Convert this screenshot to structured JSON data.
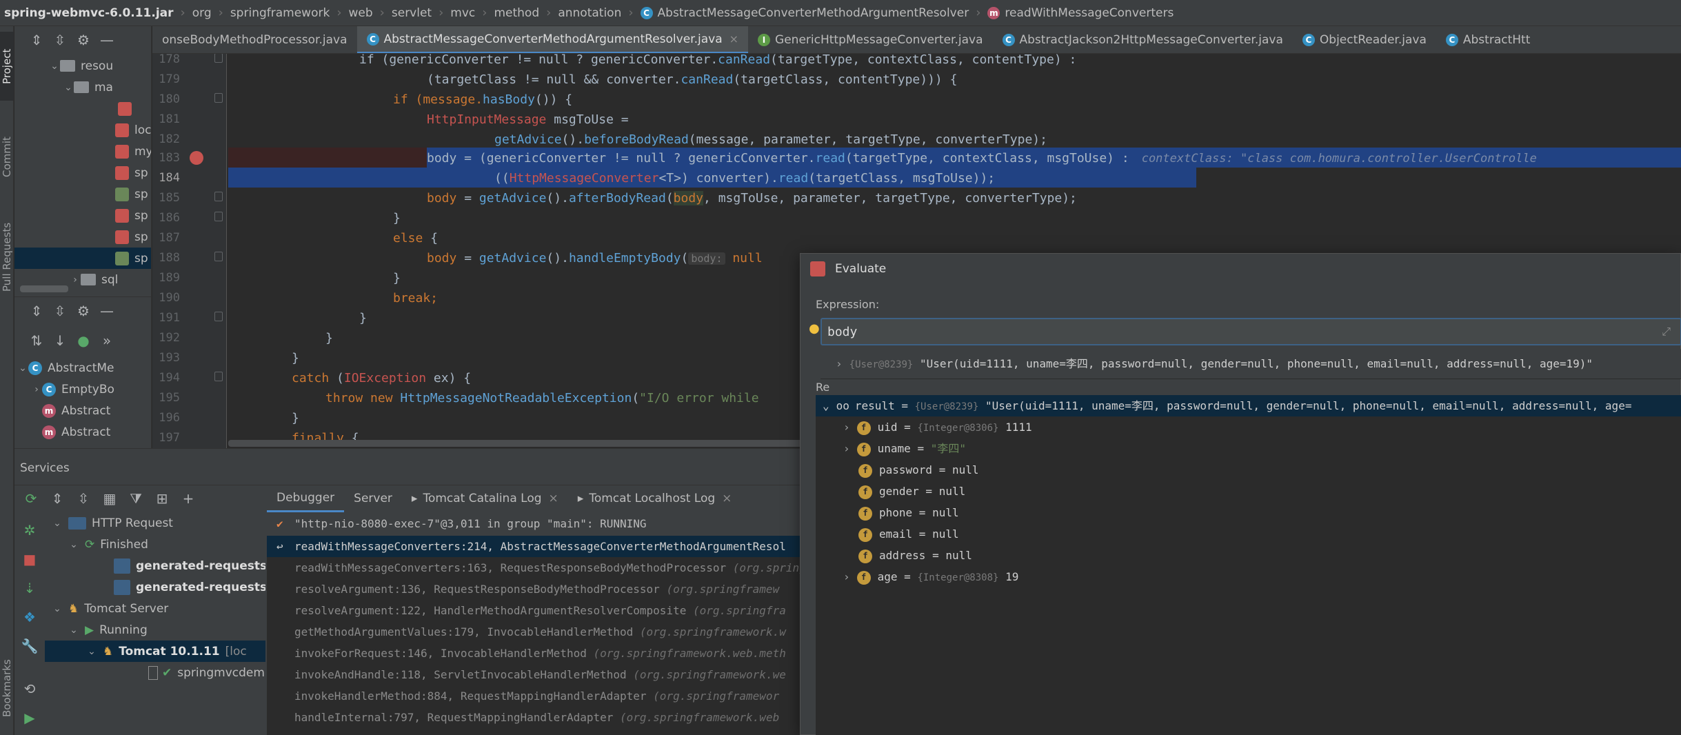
{
  "breadcrumb": [
    "spring-webmvc-6.0.11.jar",
    "org",
    "springframework",
    "web",
    "servlet",
    "mvc",
    "method",
    "annotation",
    "AbstractMessageConverterMethodArgumentResolver",
    "readWithMessageConverters"
  ],
  "left_strip": {
    "project": "Project",
    "commit": "Commit",
    "pull_requests": "Pull Requests",
    "bookmarks": "Bookmarks"
  },
  "project_tree": {
    "rows": [
      "resou",
      "ma",
      "",
      "loc",
      "my",
      "sp",
      "sp",
      "sp",
      "sp",
      "sp",
      "sql"
    ]
  },
  "structure": {
    "rows": [
      "AbstractMe",
      "EmptyBo",
      "Abstract",
      "Abstract"
    ]
  },
  "tabs": [
    {
      "label": "onseBodyMethodProcessor.java",
      "icon": "C",
      "closable": false
    },
    {
      "label": "AbstractMessageConverterMethodArgumentResolver.java",
      "icon": "C",
      "closable": true
    },
    {
      "label": "GenericHttpMessageConverter.java",
      "icon": "I",
      "closable": false
    },
    {
      "label": "AbstractJackson2HttpMessageConverter.java",
      "icon": "C",
      "closable": false
    },
    {
      "label": "ObjectReader.java",
      "icon": "C",
      "closable": false
    },
    {
      "label": "AbstractHtt",
      "icon": "C",
      "closable": false
    }
  ],
  "line_numbers": [
    "178",
    "179",
    "180",
    "181",
    "182",
    "183",
    "184",
    "185",
    "186",
    "187",
    "188",
    "189",
    "190",
    "191",
    "192",
    "193",
    "194",
    "195",
    "196",
    "197"
  ],
  "code": {
    "l178a": "if (genericConverter != null ? genericConverter.",
    "l178b": "canRead",
    "l178c": "(targetType, contextClass, contentType) :",
    "l179a": "(targetClass != null && converter.",
    "l179b": "canRead",
    "l179c": "(targetClass, contentType))) {",
    "l180a": "if (message.",
    "l180b": "hasBody",
    "l180c": "()) {",
    "l181a": "HttpInputMessage",
    "l181b": " msgToUse =",
    "l182a": "getAdvice",
    "l182b": "().",
    "l182c": "beforeBodyRead",
    "l182d": "(message, parameter, targetType, converterType);",
    "l183a": "body = (genericConverter != null ? genericConverter.",
    "l183b": "read",
    "l183c": "(targetType, contextClass, msgToUse) :",
    "l183hint": "contextClass: \"class com.homura.controller.UserControlle",
    "l184a": "((",
    "l184b": "HttpMessageConverter",
    "l184c": "<T>",
    "l184d": ") converter).",
    "l184e": "read",
    "l184f": "(targetClass, msgToUse));",
    "l185a": "body",
    "l185b": " = ",
    "l185c": "getAdvice",
    "l185d": "().",
    "l185e": "afterBodyRead",
    "l185f": "(",
    "l185g": "body",
    "l185h": ", msgToUse, parameter, targetType, converterType);",
    "l186": "}",
    "l187a": "else",
    "l187b": " {",
    "l188a": "body",
    "l188b": " = ",
    "l188c": "getAdvice",
    "l188d": "().",
    "l188e": "handleEmptyBody",
    "l188f": "(",
    "l188g": "body:",
    "l188h": " null",
    "l189": "}",
    "l190": "break;",
    "l191": "}",
    "l192": "}",
    "l193": "}",
    "l194a": "catch",
    "l194b": " (",
    "l194c": "IOException",
    "l194d": " ex) {",
    "l195a": "throw new ",
    "l195b": "HttpMessageNotReadableException",
    "l195c": "(",
    "l195d": "\"I/O error while",
    "l196": "}",
    "l197a": "finally",
    "l197b": " {"
  },
  "services": {
    "title": "Services",
    "tree": [
      {
        "label": "HTTP Request",
        "icon": "api-icon"
      },
      {
        "label": "Finished",
        "icon": "refresh-icon"
      },
      {
        "label": "generated-requests",
        "icon": "api-icon"
      },
      {
        "label": "generated-requests",
        "icon": "api-icon"
      },
      {
        "label": "Tomcat Server",
        "icon": "tomcat-icon"
      },
      {
        "label": "Running",
        "icon": "run-icon"
      },
      {
        "label": "Tomcat 10.1.11",
        "icon": "tomcat-icon",
        "suffix": "[loc"
      },
      {
        "label": "springmvcdemo.",
        "icon": "artifact-icon"
      }
    ],
    "debug_tabs": [
      "Debugger",
      "Server",
      "Tomcat Catalina Log",
      "Tomcat Localhost Log"
    ],
    "thread": "\"http-nio-8080-exec-7\"@3,011 in group \"main\": RUNNING",
    "frames": [
      {
        "text": "readWithMessageConverters:214, AbstractMessageConverterMethodArgumentResol",
        "pkg": ""
      },
      {
        "text": "readWithMessageConverters:163, RequestResponseBodyMethodProcessor ",
        "pkg": "(org.spring"
      },
      {
        "text": "resolveArgument:136, RequestResponseBodyMethodProcessor ",
        "pkg": "(org.springframew"
      },
      {
        "text": "resolveArgument:122, HandlerMethodArgumentResolverComposite ",
        "pkg": "(org.springfra"
      },
      {
        "text": "getMethodArgumentValues:179, InvocableHandlerMethod ",
        "pkg": "(org.springframework.w"
      },
      {
        "text": "invokeForRequest:146, InvocableHandlerMethod ",
        "pkg": "(org.springframework.web.meth"
      },
      {
        "text": "invokeAndHandle:118, ServletInvocableHandlerMethod ",
        "pkg": "(org.springframework.we"
      },
      {
        "text": "invokeHandlerMethod:884, RequestMappingHandlerAdapter ",
        "pkg": "(org.springframewor"
      },
      {
        "text": "handleInternal:797, RequestMappingHandlerAdapter ",
        "pkg": "(org.springframework.web"
      }
    ]
  },
  "evaluate": {
    "title": "Evaluate",
    "expression_label": "Expression:",
    "expression_value": "body",
    "suggest_ref": "{User@8239}",
    "suggest_value": "\"User(uid=1111, uname=李四, password=null, gender=null, phone=null, email=null, address=null, age=19)\"",
    "result_label": "Re",
    "result": {
      "name": "result",
      "eq": " = ",
      "ref": "{User@8239}",
      "value": "\"User(uid=1111, uname=李四, password=null, gender=null, phone=null, email=null, address=null, age="
    },
    "fields": [
      {
        "name": "uid",
        "eq": " = ",
        "ref": "{Integer@8306}",
        "value": " 1111",
        "expandable": true
      },
      {
        "name": "uname",
        "eq": " = ",
        "ref": "",
        "value": "\"李四\"",
        "expandable": true
      },
      {
        "name": "password",
        "eq": " = ",
        "ref": "",
        "value": "null",
        "expandable": false
      },
      {
        "name": "gender",
        "eq": " = ",
        "ref": "",
        "value": "null",
        "expandable": false
      },
      {
        "name": "phone",
        "eq": " = ",
        "ref": "",
        "value": "null",
        "expandable": false
      },
      {
        "name": "email",
        "eq": " = ",
        "ref": "",
        "value": "null",
        "expandable": false
      },
      {
        "name": "address",
        "eq": " = ",
        "ref": "",
        "value": "null",
        "expandable": false
      },
      {
        "name": "age",
        "eq": " = ",
        "ref": "{Integer@8308}",
        "value": " 19",
        "expandable": true
      }
    ]
  },
  "colors": {
    "accent": "#4a88c7",
    "selection": "#214283",
    "keyword": "#cc7832",
    "string": "#6a8759",
    "method": "#ffc66d"
  }
}
